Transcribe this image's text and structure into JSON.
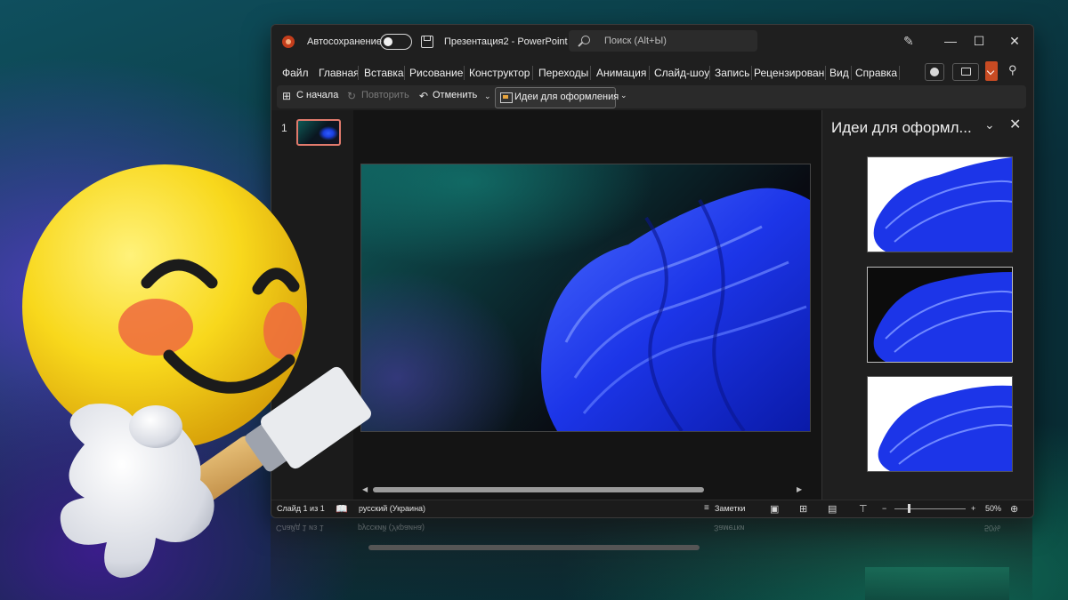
{
  "titlebar": {
    "autosave_label": "Автосохранение",
    "doc_title": "Презентация2  -  PowerPoint",
    "search_placeholder": "Поиск (Alt+Ы)",
    "minimize": "—",
    "maximize": "☐",
    "close": "✕"
  },
  "menu": {
    "items": [
      "Файл",
      "Главная",
      "Вставка",
      "Рисование",
      "Конструктор",
      "Переходы",
      "Анимация",
      "Слайд-шоу",
      "Запись",
      "Рецензирован",
      "Вид",
      "Справка"
    ]
  },
  "qat": {
    "from_start": "С начала",
    "redo": "Повторить",
    "undo": "Отменить",
    "design_ideas": "Идеи для оформления"
  },
  "thumbs": {
    "slide_number": "1"
  },
  "design_pane": {
    "title": "Идеи для оформл...",
    "cards": [
      "design-idea-1",
      "design-idea-2",
      "design-idea-3"
    ]
  },
  "status": {
    "slide_info": "Слайд 1 из 1",
    "language": "русский (Украина)",
    "notes": "Заметки",
    "zoom": "50%"
  },
  "reflection": {
    "slide_info": "Слайд 1 из 1",
    "language": "русский (Украина)",
    "notes": "Заметки",
    "zoom": "50%"
  },
  "icons": {
    "app_logo": "powerpoint-logo-icon",
    "save": "save-icon",
    "search": "search-icon",
    "pen": "pen-icon",
    "record": "record-icon",
    "comment": "comment-icon",
    "coauth": "coauthoring-icon"
  },
  "colors": {
    "accent": "#c43e1c",
    "window_bg": "#1f1f1f",
    "slide_flower": "#1f3dff"
  }
}
